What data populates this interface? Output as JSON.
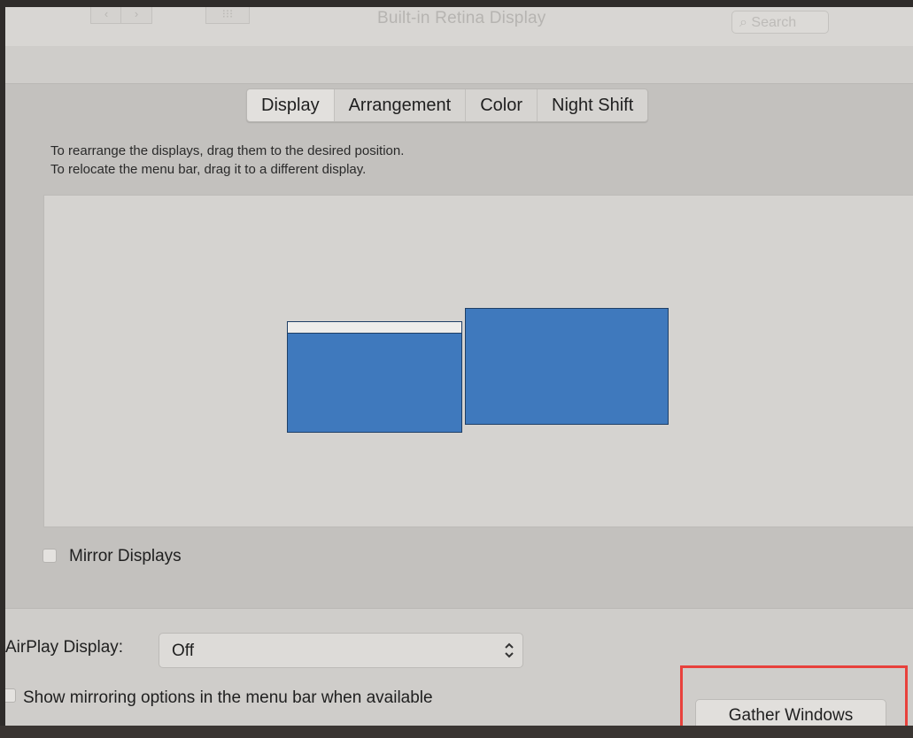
{
  "window": {
    "title": "Built-in Retina Display",
    "search_placeholder": "Search",
    "toolbar_buttons": [
      "‹",
      "›",
      "⁝⁝⁝"
    ]
  },
  "tabs": [
    {
      "label": "Display",
      "active": true
    },
    {
      "label": "Arrangement",
      "active": false
    },
    {
      "label": "Color",
      "active": false
    },
    {
      "label": "Night Shift",
      "active": false
    }
  ],
  "arrangement": {
    "instruction_line1": "To rearrange the displays, drag them to the desired position.",
    "instruction_line2": "To relocate the menu bar, drag it to a different display.",
    "display_color": "#3f79bd",
    "menubar_color": "#eeedeb"
  },
  "mirror_displays": {
    "label": "Mirror Displays",
    "checked": false
  },
  "airplay": {
    "label": "AirPlay Display:",
    "value": "Off"
  },
  "show_mirroring": {
    "label": "Show mirroring options in the menu bar when available",
    "checked": false
  },
  "gather_windows": {
    "label": "Gather Windows"
  },
  "highlight_color": "#e8413c"
}
